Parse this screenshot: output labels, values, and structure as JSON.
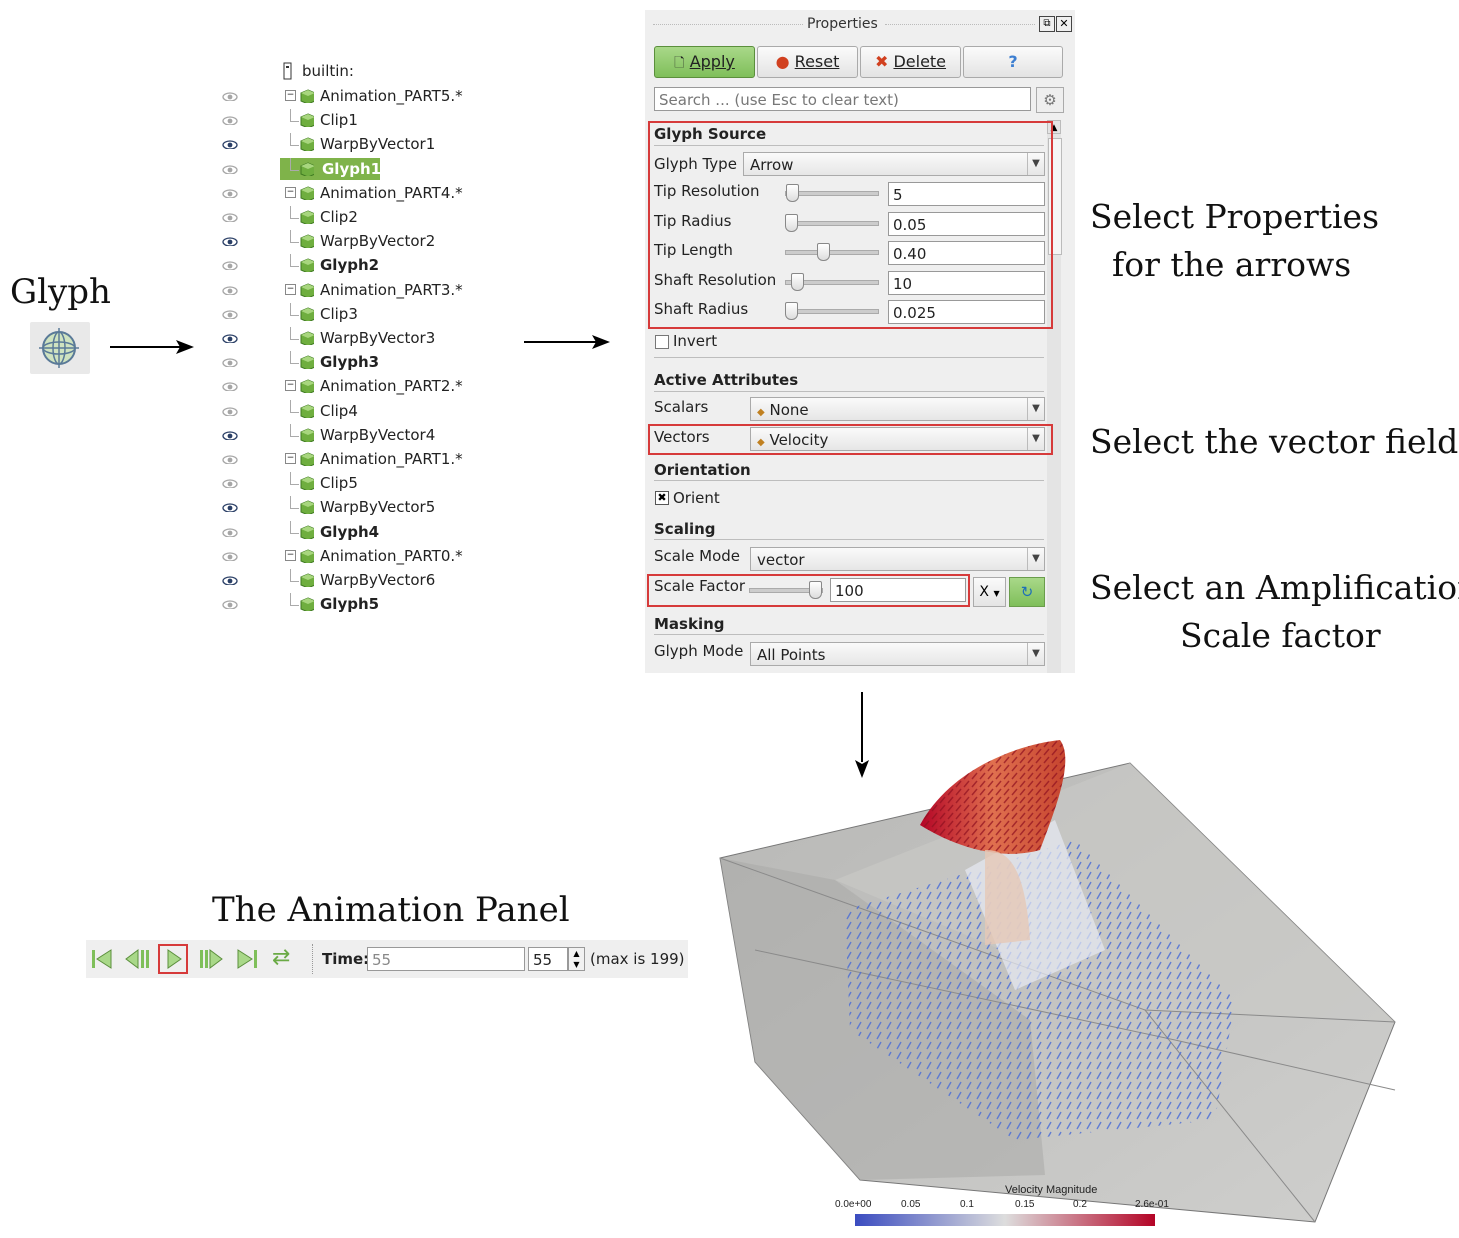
{
  "glyph_label": "Glyph",
  "pipeline": {
    "root": "builtin:",
    "items": [
      {
        "label": "Animation_PART5.*",
        "level": 0,
        "eye": "grey",
        "bold": false,
        "selected": false
      },
      {
        "label": "Clip1",
        "level": 1,
        "eye": "grey",
        "bold": false,
        "selected": false
      },
      {
        "label": "WarpByVector1",
        "level": 1,
        "eye": "dark",
        "bold": false,
        "selected": false
      },
      {
        "label": "Glyph1",
        "level": 1,
        "eye": "grey",
        "bold": true,
        "selected": true
      },
      {
        "label": "Animation_PART4.*",
        "level": 0,
        "eye": "grey",
        "bold": false,
        "selected": false
      },
      {
        "label": "Clip2",
        "level": 1,
        "eye": "grey",
        "bold": false,
        "selected": false
      },
      {
        "label": "WarpByVector2",
        "level": 1,
        "eye": "dark",
        "bold": false,
        "selected": false
      },
      {
        "label": "Glyph2",
        "level": 1,
        "eye": "grey",
        "bold": true,
        "selected": false
      },
      {
        "label": "Animation_PART3.*",
        "level": 0,
        "eye": "grey",
        "bold": false,
        "selected": false
      },
      {
        "label": "Clip3",
        "level": 1,
        "eye": "grey",
        "bold": false,
        "selected": false
      },
      {
        "label": "WarpByVector3",
        "level": 1,
        "eye": "dark",
        "bold": false,
        "selected": false
      },
      {
        "label": "Glyph3",
        "level": 1,
        "eye": "grey",
        "bold": true,
        "selected": false
      },
      {
        "label": "Animation_PART2.*",
        "level": 0,
        "eye": "grey",
        "bold": false,
        "selected": false
      },
      {
        "label": "Clip4",
        "level": 1,
        "eye": "grey",
        "bold": false,
        "selected": false
      },
      {
        "label": "WarpByVector4",
        "level": 1,
        "eye": "dark",
        "bold": false,
        "selected": false
      },
      {
        "label": "Animation_PART1.*",
        "level": 0,
        "eye": "grey",
        "bold": false,
        "selected": false
      },
      {
        "label": "Clip5",
        "level": 1,
        "eye": "grey",
        "bold": false,
        "selected": false
      },
      {
        "label": "WarpByVector5",
        "level": 1,
        "eye": "dark",
        "bold": false,
        "selected": false
      },
      {
        "label": "Glyph4",
        "level": 1,
        "eye": "grey",
        "bold": true,
        "selected": false
      },
      {
        "label": "Animation_PART0.*",
        "level": 0,
        "eye": "grey",
        "bold": false,
        "selected": false
      },
      {
        "label": "WarpByVector6",
        "level": 1,
        "eye": "dark",
        "bold": false,
        "selected": false
      },
      {
        "label": "Glyph5",
        "level": 1,
        "eye": "grey",
        "bold": true,
        "selected": false
      }
    ]
  },
  "properties": {
    "title": "Properties",
    "apply": "Apply",
    "reset": "Reset",
    "delete": "Delete",
    "help": "?",
    "search_placeholder": "Search ... (use Esc to clear text)",
    "glyph_source": "Glyph Source",
    "glyph_type_label": "Glyph Type",
    "glyph_type_value": "Arrow",
    "tip_resolution_label": "Tip Resolution",
    "tip_resolution_value": "5",
    "tip_radius_label": "Tip Radius",
    "tip_radius_value": "0.05",
    "tip_length_label": "Tip Length",
    "tip_length_value": "0.40",
    "shaft_resolution_label": "Shaft Resolution",
    "shaft_resolution_value": "10",
    "shaft_radius_label": "Shaft Radius",
    "shaft_radius_value": "0.025",
    "invert_label": "Invert",
    "active_attributes": "Active Attributes",
    "scalars_label": "Scalars",
    "scalars_value": "None",
    "vectors_label": "Vectors",
    "vectors_value": "Velocity",
    "orientation": "Orientation",
    "orient_label": "Orient",
    "scaling": "Scaling",
    "scale_mode_label": "Scale Mode",
    "scale_mode_value": "vector",
    "scale_factor_label": "Scale Factor",
    "scale_factor_value": "100",
    "axis_button": "X",
    "masking": "Masking",
    "glyph_mode_label": "Glyph Mode",
    "glyph_mode_value": "All Points"
  },
  "notes": {
    "props_line1": "Select Properties",
    "props_line2": "for the arrows",
    "vector_field": "Select the vector field",
    "amp_line1": "Select an Amplification",
    "amp_line2": "Scale factor"
  },
  "animation": {
    "title": "The Animation Panel",
    "time_label": "Time:",
    "time_value": "55",
    "step_value": "55",
    "max_text": "(max is 199)"
  },
  "colorbar": {
    "title": "Velocity Magnitude",
    "ticks": [
      "0.0e+00",
      "0.05",
      "0.1",
      "0.15",
      "0.2",
      "2.6e-01"
    ],
    "colors": [
      "#3b4cc0",
      "#dddddd",
      "#b40426"
    ]
  }
}
